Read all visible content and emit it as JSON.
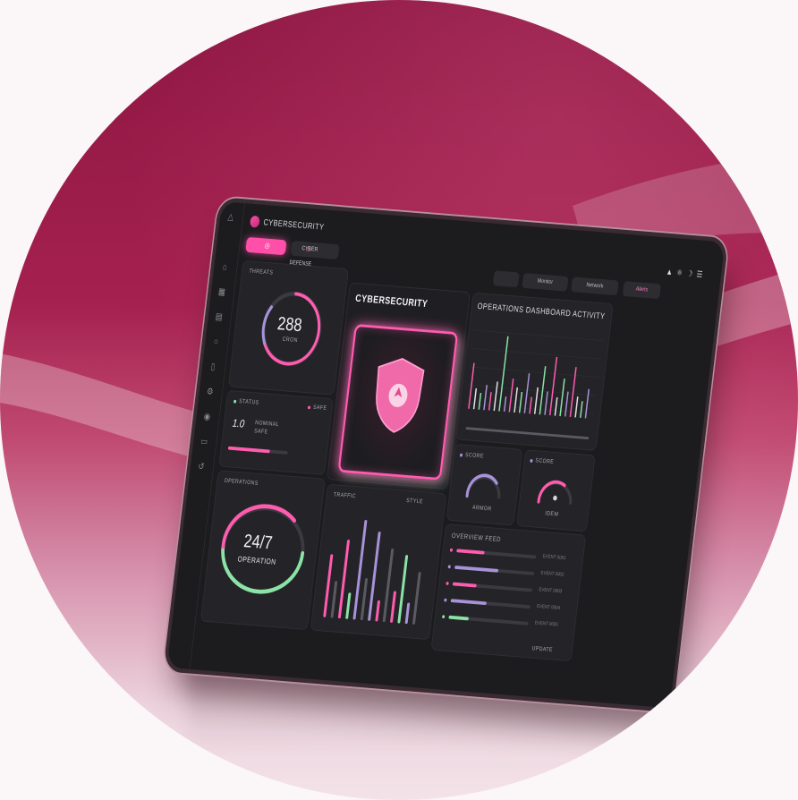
{
  "header": {
    "brand": "CYBERSECURITY",
    "tab_secondary": "CYBER DEFENSE",
    "buttons": [
      "",
      "Monitor",
      "Network",
      "Alerts"
    ]
  },
  "metrics": {
    "threats_label": "THREATS",
    "threats_value": "288",
    "threats_unit": "CRON",
    "status_label": "STATUS",
    "status_line1": "NOMINAL",
    "status_line2": "SAFE",
    "status_value": "1.0",
    "status_tag": "SAFE"
  },
  "shield_panel": {
    "title": "CYBERSECURITY"
  },
  "activity": {
    "title": "OPERATIONS DASHBOARD ACTIVITY",
    "bars": [
      0.55,
      0.25,
      0.2,
      0.3,
      0.22,
      0.35,
      0.9,
      0.18,
      0.4,
      0.3,
      0.25,
      0.48,
      0.2,
      0.32,
      0.58,
      0.28,
      0.7,
      0.22,
      0.45,
      0.3,
      0.6,
      0.25,
      0.2,
      0.35
    ]
  },
  "gauges": [
    {
      "label": "SCORE",
      "value_label": "ARMOR",
      "level": 0.7
    },
    {
      "label": "SCORE",
      "value_label": "IDEM",
      "level": 0.6
    }
  ],
  "ops": {
    "label": "OPERATIONS",
    "value": "24/7",
    "sub": "OPERATION",
    "level": 0.78
  },
  "traffic": {
    "label": "TRAFFIC",
    "right_label": "STYLE",
    "bars": [
      0.6,
      0.35,
      0.75,
      0.25,
      0.95,
      0.4,
      0.85,
      0.2,
      0.7,
      0.3,
      0.65,
      0.2,
      0.5
    ]
  },
  "events": {
    "title": "OVERVIEW FEED",
    "rows": [
      {
        "text": "EVENT 0001",
        "level": 0.35,
        "color": "#ff5cb0"
      },
      {
        "text": "EVENT 0002",
        "level": 0.55,
        "color": "#a892d8"
      },
      {
        "text": "EVENT 0003",
        "level": 0.3,
        "color": "#ff5cb0"
      },
      {
        "text": "EVENT 0004",
        "level": 0.45,
        "color": "#a892d8"
      },
      {
        "text": "EVENT 0005",
        "level": 0.25,
        "color": "#8be3a6"
      }
    ],
    "footer": "UPDATE"
  },
  "colors": {
    "accent": "#ff5cb0",
    "green": "#8be3a6",
    "purple": "#a892d8",
    "panel": "#242428"
  },
  "icons": [
    "bell-icon",
    "home-icon",
    "grid-icon",
    "chart-icon",
    "shield-icon",
    "lock-icon",
    "settings-icon",
    "users-icon",
    "folder-icon",
    "logout-icon"
  ]
}
